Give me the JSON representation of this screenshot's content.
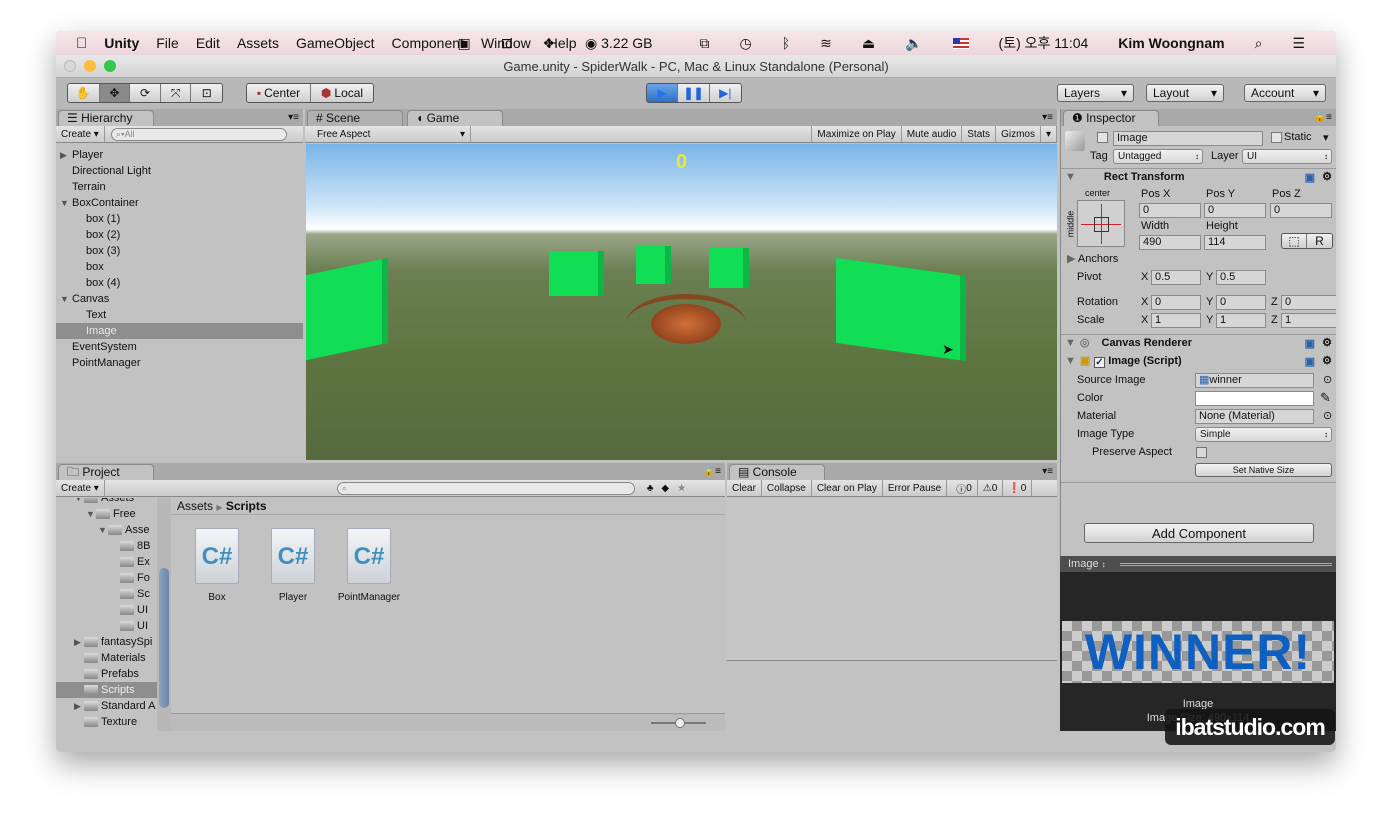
{
  "menubar": {
    "apple": "",
    "app": "Unity",
    "items": [
      "File",
      "Edit",
      "Assets",
      "GameObject",
      "Component",
      "Window",
      "Help"
    ],
    "memory": "3.22 GB",
    "clock": "(토) 오후 11:04",
    "user": "Kim Woongnam"
  },
  "window": {
    "title": "Game.unity - SpiderWalk - PC, Mac & Linux Standalone (Personal)"
  },
  "toolbar": {
    "pivot": "Center",
    "space": "Local",
    "layers": "Layers",
    "layout": "Layout",
    "account": "Account"
  },
  "hierarchy": {
    "tab": "Hierarchy",
    "create": "Create",
    "search_placeholder": "All",
    "items": [
      {
        "label": "Player",
        "indent": 0,
        "arrow": "▶"
      },
      {
        "label": "Directional Light",
        "indent": 0
      },
      {
        "label": "Terrain",
        "indent": 0
      },
      {
        "label": "BoxContainer",
        "indent": 0,
        "arrow": "▼"
      },
      {
        "label": "box (1)",
        "indent": 1
      },
      {
        "label": "box (2)",
        "indent": 1
      },
      {
        "label": "box (3)",
        "indent": 1
      },
      {
        "label": "box",
        "indent": 1
      },
      {
        "label": "box (4)",
        "indent": 1
      },
      {
        "label": "Canvas",
        "indent": 0,
        "arrow": "▼"
      },
      {
        "label": "Text",
        "indent": 1
      },
      {
        "label": "Image",
        "indent": 1,
        "selected": true
      },
      {
        "label": "EventSystem",
        "indent": 0
      },
      {
        "label": "PointManager",
        "indent": 0
      }
    ]
  },
  "scene_tab": "Scene",
  "game_tab": "Game",
  "game": {
    "aspect": "Free Aspect",
    "buttons": [
      "Maximize on Play",
      "Mute audio",
      "Stats",
      "Gizmos"
    ],
    "score": "0"
  },
  "inspector": {
    "tab": "Inspector",
    "name": "Image",
    "static": "Static",
    "tag_label": "Tag",
    "tag": "Untagged",
    "layer_label": "Layer",
    "layer": "UI",
    "rect": {
      "title": "Rect Transform",
      "anchor_h": "center",
      "anchor_v": "middle",
      "posx_label": "Pos X",
      "posy_label": "Pos Y",
      "posz_label": "Pos Z",
      "posx": "0",
      "posy": "0",
      "posz": "0",
      "width_label": "Width",
      "height_label": "Height",
      "width": "490",
      "height": "114",
      "r": "R",
      "anchors": "Anchors",
      "pivot": "Pivot",
      "pivot_x": "0.5",
      "pivot_y": "0.5",
      "rotation": "Rotation",
      "rot": [
        "0",
        "0",
        "0"
      ],
      "scale": "Scale",
      "scl": [
        "1",
        "1",
        "1"
      ],
      "x": "X",
      "y": "Y",
      "z": "Z"
    },
    "canvas_renderer": "Canvas Renderer",
    "image": {
      "title": "Image (Script)",
      "source_label": "Source Image",
      "source": "winner",
      "color_label": "Color",
      "color": "#ffffff",
      "material_label": "Material",
      "material": "None (Material)",
      "type_label": "Image Type",
      "type": "Simple",
      "preserve": "Preserve Aspect",
      "native": "Set Native Size"
    },
    "add_component": "Add Component",
    "preview": {
      "title": "Image",
      "banner": "WINNER!",
      "caption": "Image",
      "size": "Image Size: 490x114"
    }
  },
  "project": {
    "tab": "Project",
    "create": "Create",
    "breadcrumb": [
      "Assets",
      "Scripts"
    ],
    "tree": [
      {
        "label": "Assets",
        "indent": 0,
        "arrow": "▼"
      },
      {
        "label": "Free",
        "indent": 1,
        "arrow": "▼"
      },
      {
        "label": "Asse",
        "indent": 2,
        "arrow": "▼"
      },
      {
        "label": "8B",
        "indent": 3
      },
      {
        "label": "Ex",
        "indent": 3
      },
      {
        "label": "Fo",
        "indent": 3
      },
      {
        "label": "Sc",
        "indent": 3
      },
      {
        "label": "UI",
        "indent": 3
      },
      {
        "label": "UI",
        "indent": 3
      },
      {
        "label": "fantasySpi",
        "indent": 0,
        "arrow": "▶"
      },
      {
        "label": "Materials",
        "indent": 0
      },
      {
        "label": "Prefabs",
        "indent": 0
      },
      {
        "label": "Scripts",
        "indent": 0,
        "selected": true
      },
      {
        "label": "Standard A",
        "indent": 0,
        "arrow": "▶"
      },
      {
        "label": "Texture",
        "indent": 0
      }
    ],
    "files": [
      {
        "name": "Box",
        "icon": "C#"
      },
      {
        "name": "Player",
        "icon": "C#"
      },
      {
        "name": "PointManager",
        "icon": "C#"
      }
    ]
  },
  "console": {
    "tab": "Console",
    "buttons": [
      "Clear",
      "Collapse",
      "Clear on Play",
      "Error Pause"
    ],
    "counts": [
      "0",
      "0",
      "0"
    ]
  },
  "watermark": "ibatstudio.com"
}
